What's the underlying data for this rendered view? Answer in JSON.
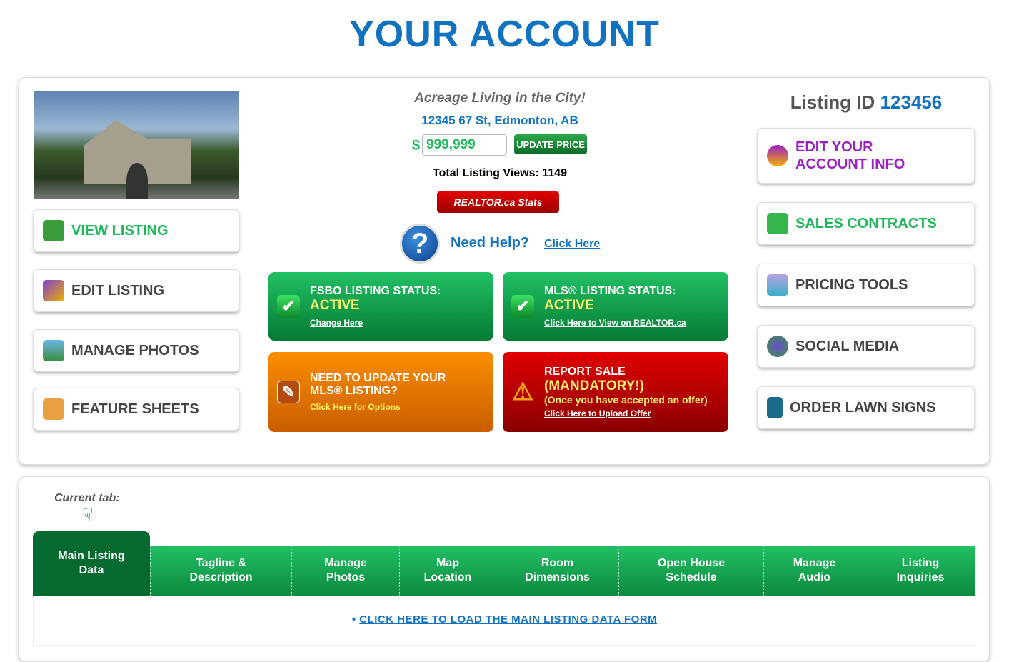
{
  "title": "YOUR ACCOUNT",
  "listing": {
    "tagline": "Acreage Living in the City!",
    "address": "12345 67 St, Edmonton, AB",
    "currency": "$",
    "price": "999,999",
    "update_price": "UPDATE PRICE",
    "views_label": "Total Listing Views:",
    "views": "1149",
    "realtor_stats": "REALTOR.ca Stats",
    "help": "Need Help?",
    "help_link": "Click Here",
    "id_label": "Listing ID",
    "id": "123456"
  },
  "left_buttons": [
    {
      "label": "VIEW LISTING",
      "icon": "magnifier-photo-icon"
    },
    {
      "label": "EDIT LISTING",
      "icon": "pencil-icon"
    },
    {
      "label": "MANAGE PHOTOS",
      "icon": "camera-icon"
    },
    {
      "label": "FEATURE SHEETS",
      "icon": "clipboard-icon"
    }
  ],
  "right_buttons": [
    {
      "label": "EDIT YOUR ACCOUNT INFO",
      "icon": "user-icon"
    },
    {
      "label": "SALES CONTRACTS",
      "icon": "book-icon"
    },
    {
      "label": "PRICING TOOLS",
      "icon": "chart-icon"
    },
    {
      "label": "SOCIAL MEDIA",
      "icon": "people-icon"
    },
    {
      "label": "ORDER LAWN SIGNS",
      "icon": "sign-icon"
    }
  ],
  "status": {
    "fsbo": {
      "title": "FSBO LISTING STATUS:",
      "value": "ACTIVE",
      "link": "Change Here"
    },
    "mls": {
      "title": "MLS® LISTING STATUS:",
      "value": "ACTIVE",
      "link": "Click Here to View on REALTOR.ca"
    },
    "update": {
      "title": "NEED TO UPDATE YOUR",
      "title2": "MLS® LISTING?",
      "link": "Click Here for Options"
    },
    "report": {
      "title": "REPORT SALE",
      "value": "(MANDATORY!)",
      "note": "(Once you have accepted an offer)",
      "link": "Click Here to Upload Offer"
    }
  },
  "colors": {
    "brand_blue": "#1173c0",
    "green": "#1fb85c",
    "orange": "#f28a00",
    "red": "#d00000",
    "purple": "#9b1fc4"
  },
  "tabs": {
    "current_label": "Current tab:",
    "items": [
      "Main Listing Data",
      "Tagline & Description",
      "Manage Photos",
      "Map Location",
      "Room Dimensions",
      "Open House Schedule",
      "Manage Audio",
      "Listing Inquiries"
    ],
    "active": 0,
    "load_link": "CLICK HERE TO LOAD THE MAIN LISTING DATA FORM"
  }
}
